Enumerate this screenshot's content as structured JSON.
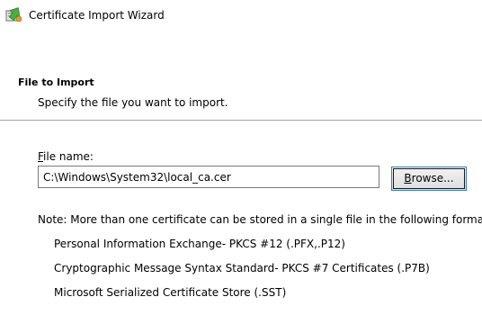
{
  "window": {
    "title": "Certificate Import Wizard",
    "icon": "certificate-wizard-icon"
  },
  "section": {
    "title": "File to Import",
    "subtitle": "Specify the file you want to import."
  },
  "file_field": {
    "label": "File name:",
    "value": "C:\\Windows\\System32\\local_ca.cer"
  },
  "browse_button": {
    "label": "Browse..."
  },
  "note": "Note:  More than one certificate can be stored in a single file in the following formats:",
  "formats": [
    "Personal Information Exchange- PKCS #12 (.PFX,.P12)",
    "Cryptographic Message Syntax Standard- PKCS #7 Certificates (.P7B)",
    "Microsoft Serialized Certificate Store (.SST)"
  ]
}
